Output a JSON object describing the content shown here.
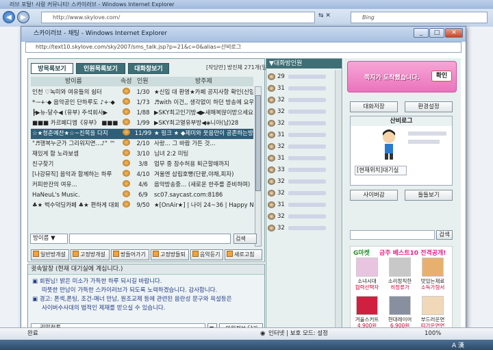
{
  "browser": {
    "title": "러브 포탈! 사랑 커뮤니티! 스카이러브 - Windows Internet Explorer",
    "url": "http://www.skylove.com/",
    "search_placeholder": "Bing",
    "go_label": "이동"
  },
  "popup": {
    "title": "스카이러브 - 채팅 - Windows Internet Explorer",
    "url": "http://text10.skylove.com/sky2007/sms_talk.jsp?p=21&c=0&alias=산비로그"
  },
  "tabs": [
    "방목록보기",
    "인원목록보기",
    "대화창보기"
  ],
  "status_line": "[작당만] 방진체 271개(일반:237, 음악:34)",
  "columns": {
    "name": "방이름",
    "attr": "속성",
    "count": "인원",
    "title": "방주제"
  },
  "rooms": [
    {
      "name": "인천 ♡녹미와 여유들의 쉼터",
      "count": "1/30",
      "title": "★신입 대 환영★카페 공지사항 확인(신입!"
    },
    {
      "name": "*·─+·◆ 음악공인 단하루도 ♪+·◆",
      "count": "1/73",
      "title": "♬with 이건,, 생각없이 하던 방송에 요우"
    },
    {
      "name": "┣▶뉴-달수◀ (유부) 주석회사▶",
      "count": "1/88",
      "title": "▶SKY최고인기방◀▶새해복많이받으세요"
    },
    {
      "name": "■■■ 카르페디엠《유부》 ■■■",
      "count": "1/99",
      "title": "▶SKY최고열유부방◀◈니아(남)28"
    },
    {
      "name": "☆★청춘예찬★☆~친목을 다지",
      "count": "11/99",
      "title": "★ 링크 ★ ◆제미와 웃음만이 공존하는방"
    },
    {
      "name": "\"♬행복누군가 그리워지면...♪\" ™",
      "count": "2/10",
      "title": "사랑... 그 바람 가튼 것..."
    },
    {
      "name": "재밌게 함 노라보셈",
      "count": "3/10",
      "title": "님녀 2:2 미팅"
    },
    {
      "name": "친구찾기",
      "count": "3/8",
      "title": "업무 중 잠수허용 퇴근할때까지"
    },
    {
      "name": "[나강뮤직] 음악과 함께하는 하루",
      "count": "4/10",
      "title": "겨울엔 삽립호빵(단팥,야채,피자)"
    },
    {
      "name": "커피한잔의 여유...",
      "count": "4/6",
      "title": "음악방송중... (새로운 한주를 준비하며)"
    },
    {
      "name": "HaNeuL's Music.",
      "count": "6/9",
      "title": "sc07.saycast.com:8186"
    },
    {
      "name": "♣★ 벅수덕딩카페 ♣★ 편하게 대화",
      "count": "9/50",
      "title": "★[OnAir★] | 나이 24~36 | Happy New"
    }
  ],
  "buttons": [
    "일반방개설",
    "고정방개설",
    "방들어가기",
    "고정방들퇴",
    "음악듣기",
    "새로고침"
  ],
  "search": {
    "select": "방이름",
    "button": "검색"
  },
  "chat": {
    "header": "귓속말창 (현재 대기실에 계십니다.)",
    "lines": [
      "▣ 회원님! 밝은 미소가 가득한 하루 되시길 바랍니다.",
      "따뜻한 만남이 가득한 스카이러브가 되도록 노력하겠습니다. 감사합니다.",
      "▣ 경고: 폰섹,폰팅, 조건-매너 만남, 원조교제 등에 관련된 음란성 문구와 욕설등은",
      "사이버수사대의 법적인 제재를 받으실 수 있습니다."
    ],
    "input_label": "귓말접투",
    "close_button": "인원정보 닫기"
  },
  "users_header": "▼대화방인원",
  "users": [
    "29",
    "31",
    "32",
    "32",
    "32",
    "31",
    "32",
    "31",
    "33",
    "32",
    "32",
    "31",
    "32",
    "32"
  ],
  "right": {
    "banner": "쪽지가 도착했습니다.",
    "confirm": "확인",
    "save": "대화저장",
    "settings": "환경설정",
    "nickname": "산비로그",
    "location": "[현재위치]대기실",
    "invite": "사이버감",
    "view": "들들보기",
    "search_btn": "검색",
    "promo_title": "금주 베스트10 전격공개!",
    "promo_brand": "G마켓",
    "products": [
      {
        "name": "소녀시대",
        "sub": "협력선택자"
      },
      {
        "name": "소리정직한",
        "sub": "히정류가"
      },
      {
        "name": "맛있는제료",
        "sub": "소득가형서"
      },
      {
        "name": "겨울스커트",
        "sub": "4,900원"
      },
      {
        "name": "현대레이어",
        "sub": "6,900원"
      },
      {
        "name": "부드러운면",
        "sub": "따가운면면"
      }
    ]
  },
  "statusbar": {
    "left": "완료",
    "zone": "인터넷 | 보호 모드: 설정",
    "zoom": "100%"
  },
  "taskbar": {
    "lang": "A 漢"
  }
}
